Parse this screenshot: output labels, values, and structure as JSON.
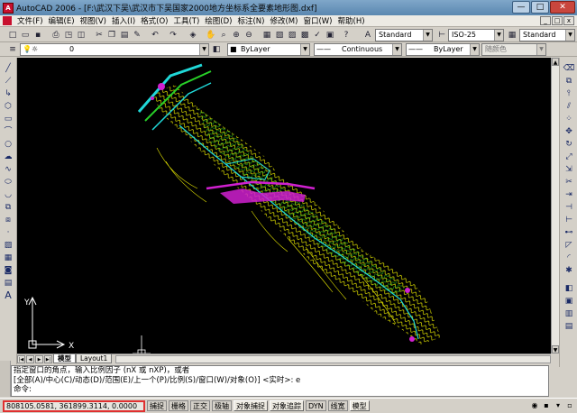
{
  "window": {
    "title": "AutoCAD 2006 - [F:\\武汉下吴\\武汉市下吴国家2000地方坐标系全要素地形图.dxf]",
    "min_glyph": "—",
    "max_glyph": "□",
    "close_glyph": "✕"
  },
  "menu": [
    "文件(F)",
    "编辑(E)",
    "视图(V)",
    "插入(I)",
    "格式(O)",
    "工具(T)",
    "绘图(D)",
    "标注(N)",
    "修改(M)",
    "窗口(W)",
    "帮助(H)"
  ],
  "menu_doc_buttons": [
    "_",
    "□",
    "x"
  ],
  "toolbar": {
    "text_style": "Standard",
    "dim_style": "ISO-25",
    "table_style": "Standard",
    "layer": "0",
    "color": "ByLayer",
    "linetype": "Continuous",
    "lineweight": "ByLayer",
    "plotstyle": "随颜色"
  },
  "ucs": {
    "y_label": "Y",
    "x_label": "X"
  },
  "tabs": {
    "model": "模型",
    "layout1": "Layout1"
  },
  "command_lines": [
    "指定窗口的角点，输入比例因子 (nX 或 nXP)，或者",
    "[全部(A)/中心(C)/动态(D)/范围(E)/上一个(P)/比例(S)/窗口(W)/对象(O)] <实时>: e",
    "命令:"
  ],
  "status": {
    "coords": "808105.0581,  361899.3114,  0.0000",
    "buttons": [
      "捕捉",
      "栅格",
      "正交",
      "极轴",
      "对象捕捉",
      "对象追踪",
      "DYN",
      "线宽",
      "模型"
    ],
    "on_buttons": [
      "对象捕捉",
      "对象追踪",
      "模型"
    ]
  },
  "colors": {
    "canvas": "#000000",
    "contour_yellow": "#e8e800",
    "contour_green": "#28d028",
    "road_cyan": "#20d8d8",
    "feature_magenta": "#d020d0",
    "highlight_red": "#e03030"
  }
}
